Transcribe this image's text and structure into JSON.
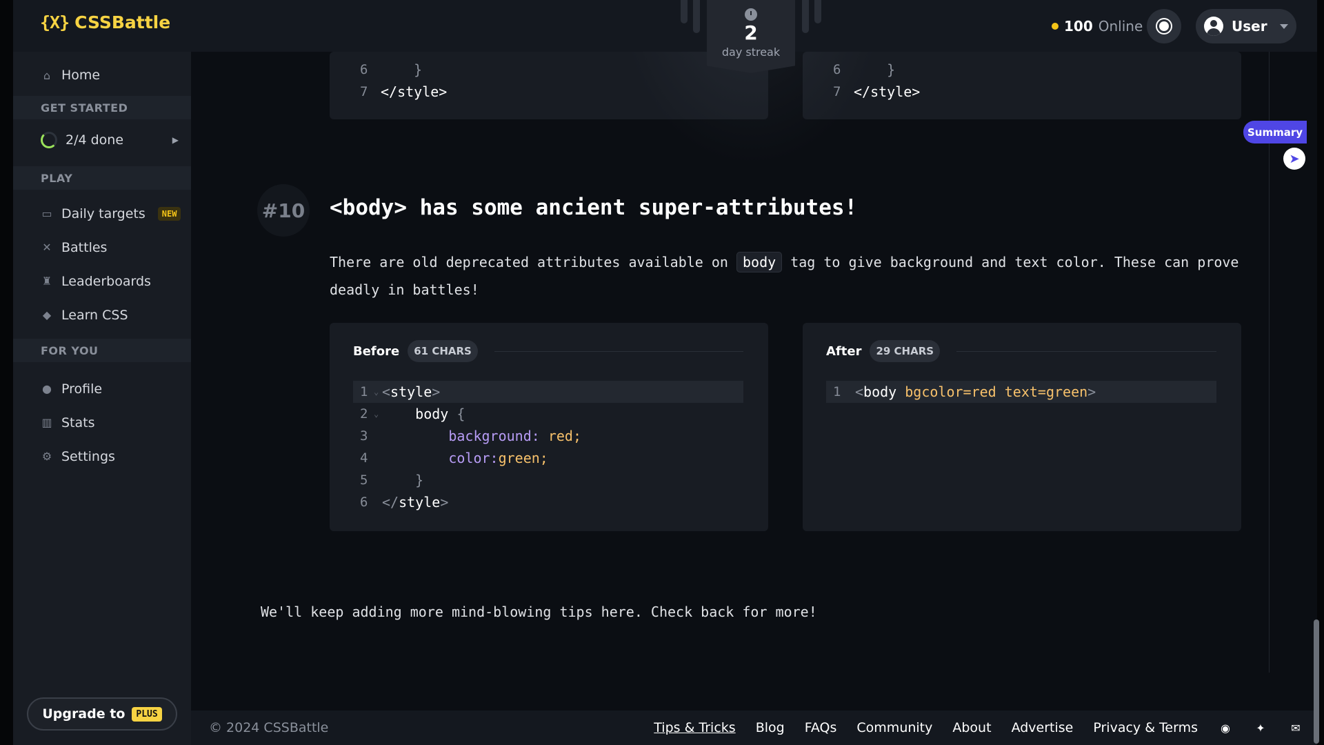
{
  "brand": {
    "logo_mark": "{X}",
    "name": "CSSBattle"
  },
  "streak": {
    "count": "2",
    "label": "day streak"
  },
  "header": {
    "online_count": "100",
    "online_label": "Online",
    "user_label": "User"
  },
  "sidebar": {
    "home": "Home",
    "sections": {
      "get_started": "GET STARTED",
      "play": "PLAY",
      "for_you": "FOR YOU"
    },
    "progress": "2/4 done",
    "play_items": [
      {
        "label": "Daily targets",
        "badge": "NEW"
      },
      {
        "label": "Battles"
      },
      {
        "label": "Leaderboards"
      },
      {
        "label": "Learn CSS"
      }
    ],
    "you_items": [
      {
        "label": "Profile"
      },
      {
        "label": "Stats"
      },
      {
        "label": "Settings"
      }
    ],
    "upgrade_label": "Upgrade to",
    "upgrade_badge": "PLUS"
  },
  "previous_tip": {
    "left_lines": [
      {
        "n": "6",
        "code": "    }"
      },
      {
        "n": "7",
        "code": "</style>"
      }
    ],
    "right_lines": [
      {
        "n": "6",
        "code": "    }"
      },
      {
        "n": "7",
        "code": "</style>"
      }
    ]
  },
  "tip": {
    "number": "#10",
    "title": "<body> has some ancient super-attributes!",
    "desc_before": "There are old deprecated attributes available on ",
    "desc_code": "body",
    "desc_after": " tag to give background and text color. These can prove deadly in battles!",
    "before": {
      "label": "Before",
      "chars": "61 CHARS",
      "lines": [
        "1",
        "2",
        "3",
        "4",
        "5",
        "6"
      ]
    },
    "after": {
      "label": "After",
      "chars": "29 CHARS",
      "lines": [
        "1"
      ]
    }
  },
  "closing_note": "We'll keep adding more mind-blowing tips here. Check back for more!",
  "summary_label": "Summary",
  "footer": {
    "copyright": "© 2024 CSSBattle",
    "links": [
      "Tips & Tricks",
      "Blog",
      "FAQs",
      "Community",
      "About",
      "Advertise",
      "Privacy & Terms"
    ]
  },
  "colors": {
    "accent": "#f7d343",
    "summary": "#4f46e5",
    "progress": "#9be35b"
  }
}
